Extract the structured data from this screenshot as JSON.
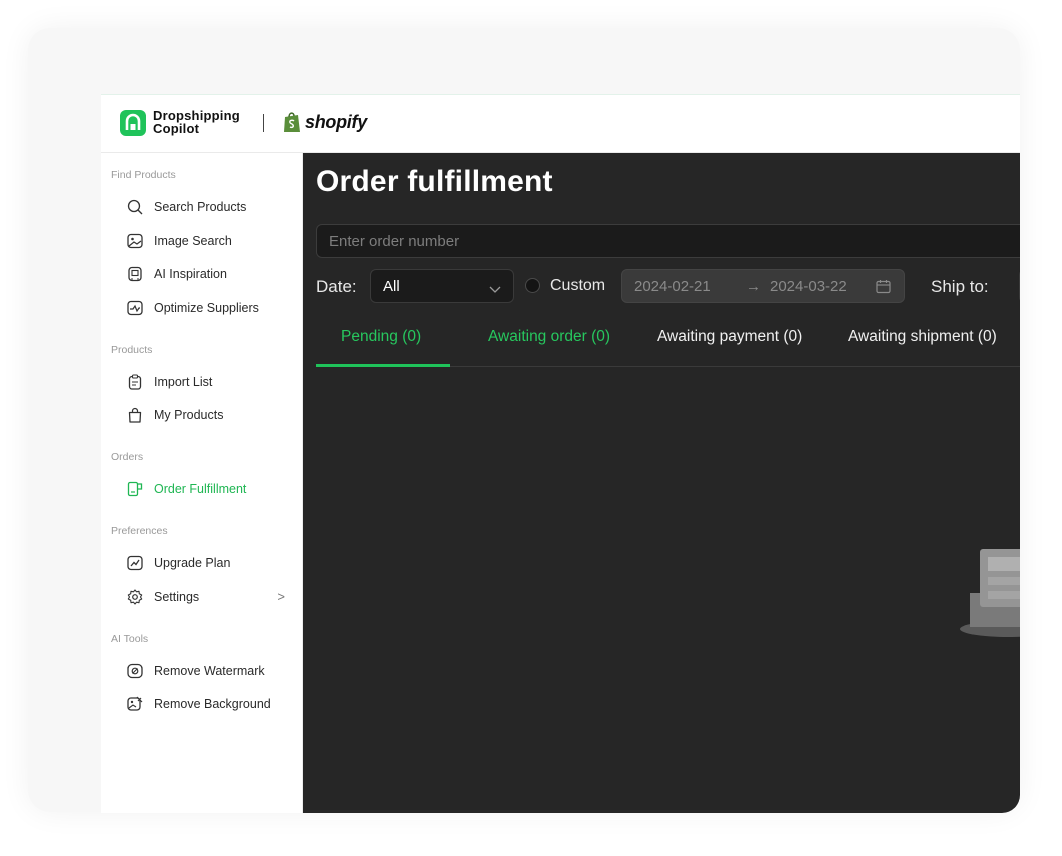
{
  "brand": {
    "name_line1": "Dropshipping",
    "name_line2": "Copilot",
    "partner": "shopify",
    "accent_color": "#1fc35a"
  },
  "sidebar": {
    "sections": [
      {
        "title": "Find Products",
        "items": [
          {
            "label": "Search Products",
            "icon": "search-icon"
          },
          {
            "label": "Image Search",
            "icon": "image-icon"
          },
          {
            "label": "AI Inspiration",
            "icon": "ai-icon"
          },
          {
            "label": "Optimize Suppliers",
            "icon": "optimize-icon"
          }
        ]
      },
      {
        "title": "Products",
        "items": [
          {
            "label": "Import List",
            "icon": "clipboard-icon"
          },
          {
            "label": "My Products",
            "icon": "bag-icon"
          }
        ]
      },
      {
        "title": "Orders",
        "items": [
          {
            "label": "Order Fulfillment",
            "icon": "fulfillment-icon",
            "active": true
          }
        ]
      },
      {
        "title": "Preferences",
        "items": [
          {
            "label": "Upgrade Plan",
            "icon": "chart-icon"
          },
          {
            "label": "Settings",
            "icon": "gear-icon",
            "chevron": ">"
          }
        ]
      },
      {
        "title": "AI Tools",
        "items": [
          {
            "label": "Remove Watermark",
            "icon": "watermark-icon"
          },
          {
            "label": "Remove Background",
            "icon": "background-icon"
          }
        ]
      }
    ]
  },
  "main": {
    "title": "Order fulfillment",
    "search_placeholder": "Enter order number",
    "date_label": "Date:",
    "date_value": "All",
    "custom_label": "Custom",
    "date_start": "2024-02-21",
    "date_arrow": "→",
    "date_end": "2024-03-22",
    "ship_to_label": "Ship to:",
    "tabs": [
      {
        "label": "Pending (0)",
        "active": true
      },
      {
        "label": "Awaiting order (0)"
      },
      {
        "label": "Awaiting payment (0)"
      },
      {
        "label": "Awaiting shipment (0)"
      }
    ]
  }
}
